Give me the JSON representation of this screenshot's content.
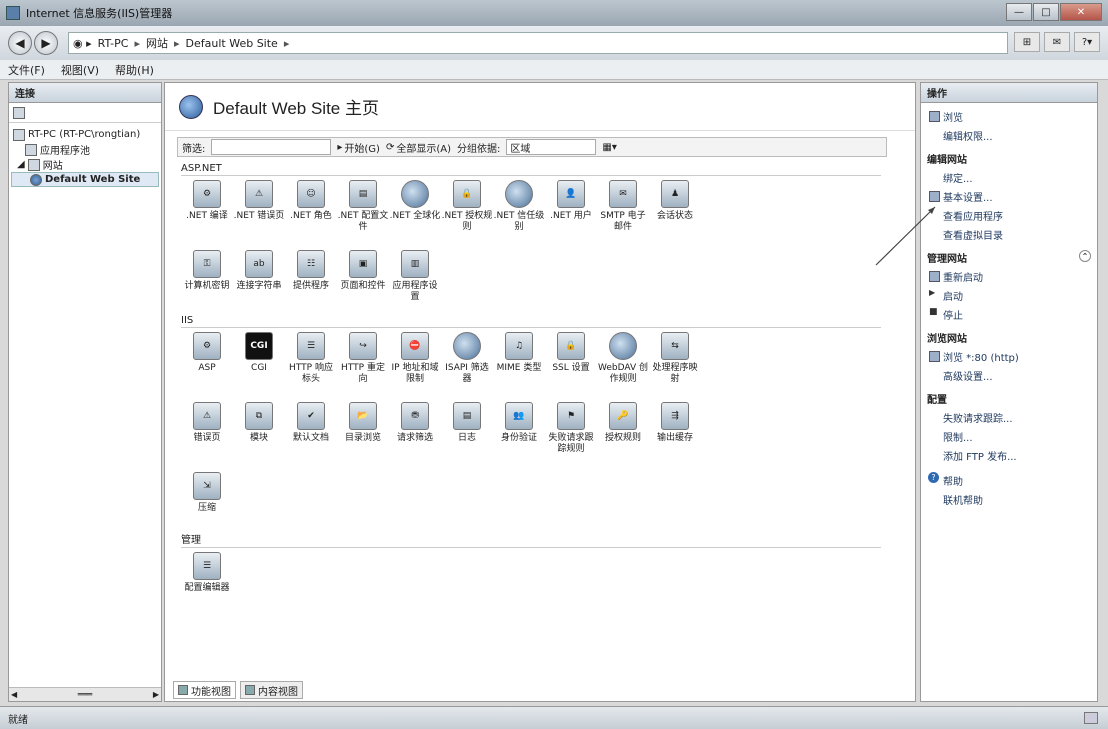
{
  "window": {
    "title": "Internet 信息服务(IIS)管理器"
  },
  "address": {
    "crumbs": [
      "RT-PC",
      "网站",
      "Default Web Site"
    ]
  },
  "menu": [
    "文件(F)",
    "视图(V)",
    "帮助(H)"
  ],
  "connections": {
    "header": "连接",
    "tree": [
      {
        "label": "RT-PC (RT-PC\\rongtian)",
        "level": 0
      },
      {
        "label": "应用程序池",
        "level": 1
      },
      {
        "label": "网站",
        "level": 1
      },
      {
        "label": "Default Web Site",
        "level": 2
      }
    ]
  },
  "main": {
    "title": "Default Web Site 主页",
    "filter": {
      "label": "筛选:",
      "go": "开始(G)",
      "show_all": "全部显示(A)",
      "group_by": "分组依据:",
      "group_value": "区域"
    },
    "sections": [
      {
        "name": "ASP.NET",
        "items": [
          ".NET 编译",
          ".NET 错误页",
          ".NET 角色",
          ".NET 配置文件",
          ".NET 全球化",
          ".NET 授权规则",
          ".NET 信任级别",
          ".NET 用户",
          "SMTP 电子邮件",
          "会话状态",
          "计算机密钥",
          "连接字符串",
          "提供程序",
          "页面和控件",
          "应用程序设置"
        ]
      },
      {
        "name": "IIS",
        "items": [
          "ASP",
          "CGI",
          "HTTP 响应标头",
          "HTTP 重定向",
          "IP 地址和域限制",
          "ISAPI 筛选器",
          "MIME 类型",
          "SSL 设置",
          "WebDAV 创作规则",
          "处理程序映射",
          "错误页",
          "模块",
          "默认文档",
          "目录浏览",
          "请求筛选",
          "日志",
          "身份验证",
          "失败请求跟踪规则",
          "授权规则",
          "输出缓存",
          "压缩"
        ]
      },
      {
        "name": "管理",
        "items": [
          "配置编辑器"
        ]
      }
    ],
    "view_tabs": [
      "功能视图",
      "内容视图"
    ]
  },
  "actions": {
    "header": "操作",
    "groups": [
      {
        "heading": "",
        "items": [
          "浏览",
          "编辑权限..."
        ]
      },
      {
        "heading": "编辑网站",
        "items": [
          "绑定...",
          "基本设置...",
          "查看应用程序",
          "查看虚拟目录"
        ]
      },
      {
        "heading": "管理网站",
        "items": [
          "重新启动",
          "启动",
          "停止"
        ]
      },
      {
        "heading": "浏览网站",
        "items": [
          "浏览 *:80 (http)",
          "高级设置..."
        ]
      },
      {
        "heading": "配置",
        "items": [
          "失败请求跟踪...",
          "限制...",
          "添加 FTP 发布..."
        ]
      },
      {
        "heading": "",
        "items": [
          "帮助",
          "联机帮助"
        ]
      }
    ]
  },
  "status": {
    "text": "就绪"
  },
  "icons": {
    "CGI": "cgi-icon"
  },
  "colors": {
    "accent": "#2b5c9a"
  }
}
